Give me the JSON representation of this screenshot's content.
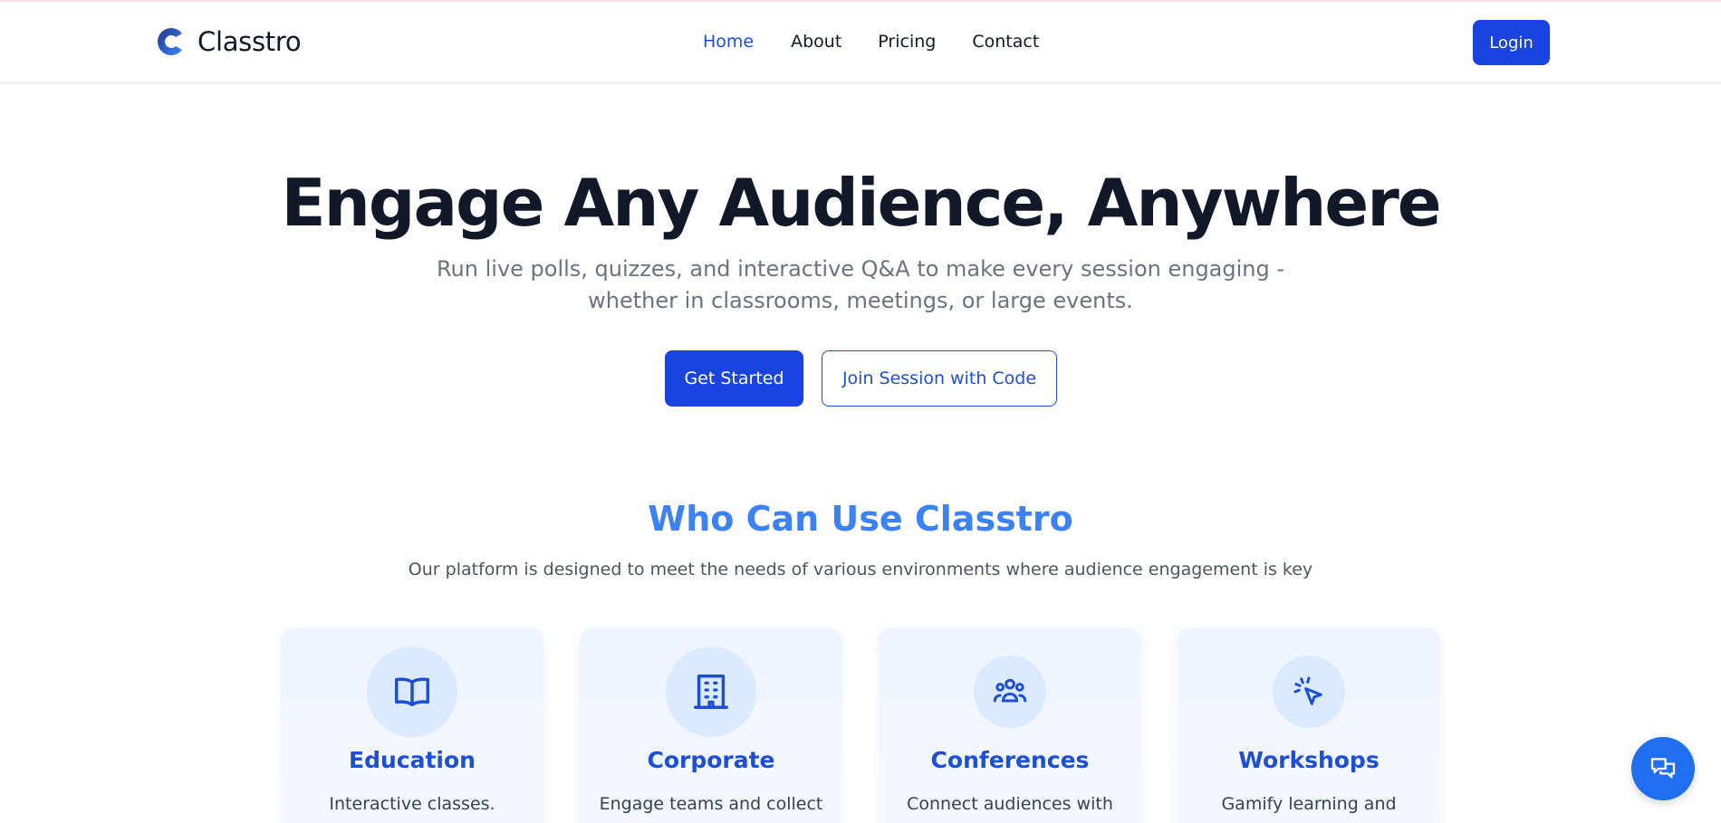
{
  "brand": {
    "name": "Classtro"
  },
  "nav": {
    "items": [
      {
        "label": "Home",
        "active": true
      },
      {
        "label": "About"
      },
      {
        "label": "Pricing"
      },
      {
        "label": "Contact"
      }
    ],
    "login_label": "Login"
  },
  "hero": {
    "title": "Engage Any Audience, Anywhere",
    "subtitle": "Run live polls, quizzes, and interactive Q&A to make every session engaging - whether in classrooms, meetings, or large events.",
    "primary_cta": "Get Started",
    "secondary_cta": "Join Session with Code"
  },
  "audience": {
    "title": "Who Can Use Classtro",
    "subtitle": "Our platform is designed to meet the needs of various environments where audience engagement is key",
    "cards": [
      {
        "icon": "book-open-icon",
        "title": "Education",
        "desc": "Interactive classes."
      },
      {
        "icon": "building-icon",
        "title": "Corporate",
        "desc": "Engage teams and collect"
      },
      {
        "icon": "users-group-icon",
        "title": "Conferences",
        "desc": "Connect audiences with"
      },
      {
        "icon": "cursor-click-icon",
        "title": "Workshops",
        "desc": "Gamify learning and"
      }
    ]
  },
  "chat": {
    "icon": "chat-bubbles-icon"
  },
  "colors": {
    "primary": "#1a44e0",
    "nav_active": "#1d4ed8",
    "section_title": "#3b82f6",
    "card_bg": "#eef5ff",
    "icon_circle": "#dbeafe"
  }
}
